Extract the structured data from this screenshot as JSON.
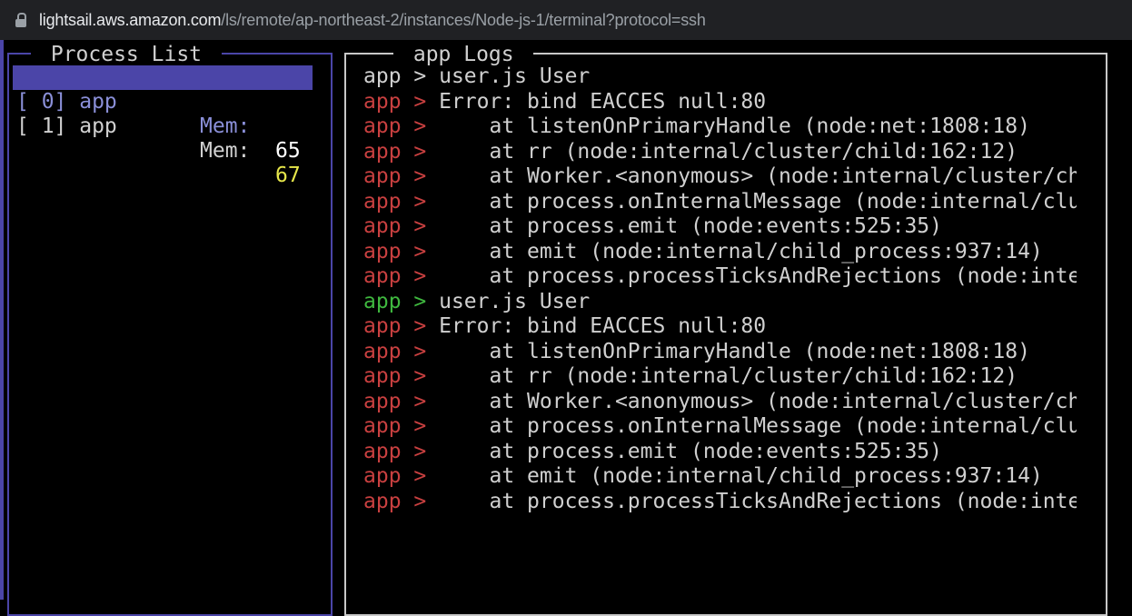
{
  "browser": {
    "url_domain": "lightsail.aws.amazon.com",
    "url_path": "/ls/remote/ap-northeast-2/instances/Node-js-1/terminal?protocol=ssh"
  },
  "process_panel": {
    "title": " Process List ",
    "processes": [
      {
        "id": "[ 0] app",
        "mem_label": "Mem:",
        "mem_value": "65",
        "selected": true
      },
      {
        "id": "[ 1] app",
        "mem_label": "Mem:",
        "mem_value": "67",
        "selected": false
      }
    ]
  },
  "logs_panel": {
    "title": " app Logs ",
    "colors": {
      "red": "#c94040",
      "green": "#3fb83f",
      "default": "#d0d0d0"
    },
    "lines": [
      {
        "prefix": "app > ",
        "color": "default",
        "message": "user.js User"
      },
      {
        "prefix": "app > ",
        "color": "red",
        "message": "Error: bind EACCES null:80"
      },
      {
        "prefix": "app > ",
        "color": "red",
        "message": "    at listenOnPrimaryHandle (node:net:1808:18)"
      },
      {
        "prefix": "app > ",
        "color": "red",
        "message": "    at rr (node:internal/cluster/child:162:12)"
      },
      {
        "prefix": "app > ",
        "color": "red",
        "message": "    at Worker.<anonymous> (node:internal/cluster/ch"
      },
      {
        "prefix": "app > ",
        "color": "red",
        "message": "    at process.onInternalMessage (node:internal/clu"
      },
      {
        "prefix": "app > ",
        "color": "red",
        "message": "    at process.emit (node:events:525:35)"
      },
      {
        "prefix": "app > ",
        "color": "red",
        "message": "    at emit (node:internal/child_process:937:14)"
      },
      {
        "prefix": "app > ",
        "color": "red",
        "message": "    at process.processTicksAndRejections (node:inte"
      },
      {
        "prefix": "app > ",
        "color": "green",
        "message": "user.js User"
      },
      {
        "prefix": "app > ",
        "color": "red",
        "message": "Error: bind EACCES null:80"
      },
      {
        "prefix": "app > ",
        "color": "red",
        "message": "    at listenOnPrimaryHandle (node:net:1808:18)"
      },
      {
        "prefix": "app > ",
        "color": "red",
        "message": "    at rr (node:internal/cluster/child:162:12)"
      },
      {
        "prefix": "app > ",
        "color": "red",
        "message": "    at Worker.<anonymous> (node:internal/cluster/ch"
      },
      {
        "prefix": "app > ",
        "color": "red",
        "message": "    at process.onInternalMessage (node:internal/clu"
      },
      {
        "prefix": "app > ",
        "color": "red",
        "message": "    at process.emit (node:events:525:35)"
      },
      {
        "prefix": "app > ",
        "color": "red",
        "message": "    at emit (node:internal/child_process:937:14)"
      },
      {
        "prefix": "app > ",
        "color": "red",
        "message": "    at process.processTicksAndRejections (node:inte"
      }
    ]
  }
}
